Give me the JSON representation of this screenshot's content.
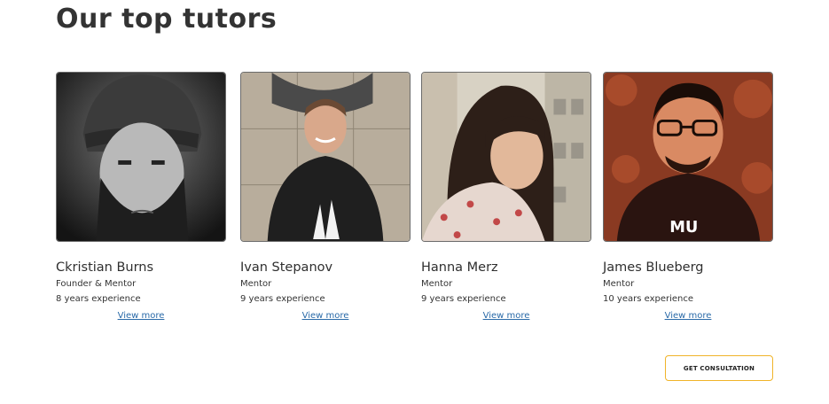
{
  "section": {
    "title": "Our top tutors"
  },
  "tutors": [
    {
      "name": "Ckristian Burns",
      "role": "Founder & Mentor",
      "experience": "8 years experience",
      "link": "View more"
    },
    {
      "name": "Ivan Stepanov",
      "role": "Mentor",
      "experience": "9 years experience",
      "link": "View more"
    },
    {
      "name": "Hanna Merz",
      "role": "Mentor",
      "experience": "9 years experience",
      "link": "View more"
    },
    {
      "name": "James Blueberg",
      "role": "Mentor",
      "experience": "10 years experience",
      "link": "View more"
    }
  ],
  "cta": {
    "label": "GET CONSULTATION"
  },
  "colors": {
    "accent_border": "#f0b429",
    "link": "#2a6aa8",
    "heading": "#333333"
  }
}
